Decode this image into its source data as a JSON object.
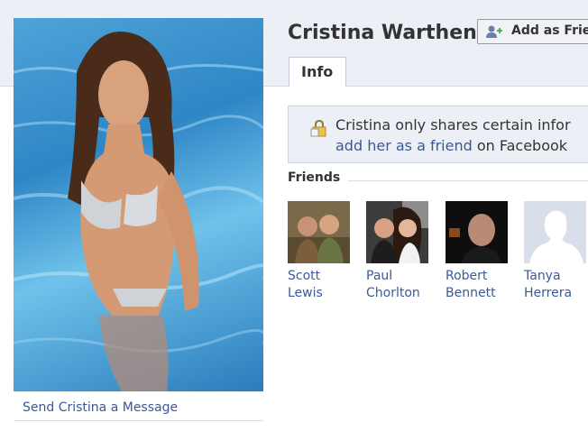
{
  "profile": {
    "name": "Cristina Warthen",
    "send_message": "Send Cristina a Message"
  },
  "actions": {
    "add_friend": "Add as Frie"
  },
  "tabs": [
    {
      "label": "Info"
    }
  ],
  "notice": {
    "line1": "Cristina only shares certain infor",
    "line2_link": "add her as a friend",
    "line2_rest": " on Facebook"
  },
  "friends": {
    "title": "Friends",
    "items": [
      {
        "first": "Scott",
        "last": "Lewis"
      },
      {
        "first": "Paul",
        "last": "Chorlton"
      },
      {
        "first": "Robert",
        "last": "Bennett"
      },
      {
        "first": "Tanya",
        "last": "Herrera"
      }
    ]
  },
  "colors": {
    "link": "#3b5998",
    "band": "#eceff5"
  }
}
